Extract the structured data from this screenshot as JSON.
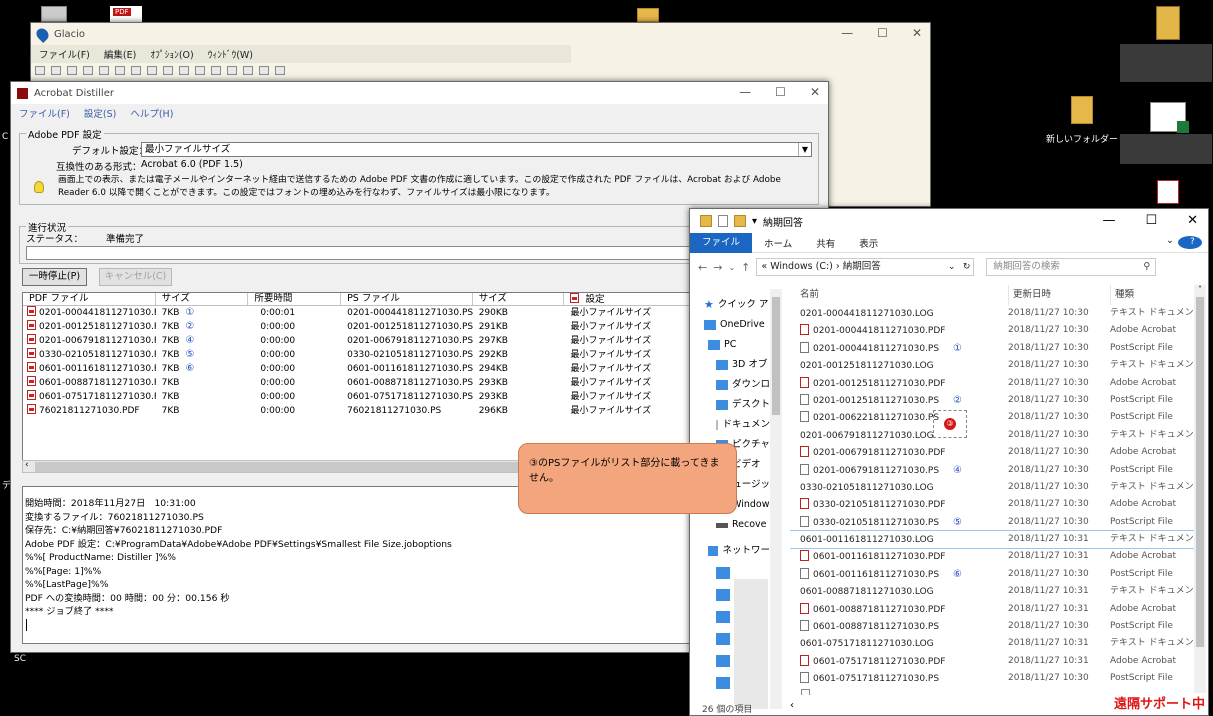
{
  "desktop": {
    "pdf_icon_label": "PDF",
    "new_folder_label": "新しいフォルダー",
    "edge_chars": [
      "C",
      "デ",
      "SC"
    ]
  },
  "glacio": {
    "title": "Glacio",
    "menu": [
      "ファイル(F)",
      "編集(E)",
      "ｵﾌﾟｼｮﾝ(O)",
      "ｳｨﾝﾄﾞｳ(W)"
    ]
  },
  "distiller": {
    "title": "Acrobat Distiller",
    "menu": [
      "ファイル(F)",
      "設定(S)",
      "ヘルプ(H)"
    ],
    "pdf_settings_group": "Adobe PDF 設定",
    "default_settings_label": "デフォルト設定：",
    "default_settings_value": "最小ファイルサイズ",
    "compat_label": "互換性のある形式：",
    "compat_value": "Acrobat 6.0 (PDF 1.5)",
    "description": "画面上での表示、または電子メールやインターネット経由で送信するための Adobe PDF 文書の作成に適しています。この設定で作成された PDF ファイルは、Acrobat および Adobe Reader 6.0 以降で開くことができます。この設定ではフォントの埋め込みを行なわず、ファイルサイズは最小限になります。",
    "progress_group": "進行状況",
    "status_label": "ステータス：",
    "status_value": "準備完了",
    "pause_button": "一時停止(P)",
    "cancel_button": "キャンセル(C)",
    "table_headers": [
      "PDF ファイル",
      "サイズ",
      "所要時間",
      "PS ファイル",
      "サイズ",
      "設定"
    ],
    "rows": [
      {
        "pdf": "0201-000441811271030.P...",
        "size": "7KB",
        "mark": "①",
        "time": "0:00:01",
        "ps": "0201-000441811271030.PS",
        "ps_size": "290KB",
        "setting": "最小ファイルサイズ"
      },
      {
        "pdf": "0201-001251811271030.P...",
        "size": "7KB",
        "mark": "②",
        "time": "0:00:00",
        "ps": "0201-001251811271030.PS",
        "ps_size": "291KB",
        "setting": "最小ファイルサイズ"
      },
      {
        "pdf": "0201-006791811271030.P...",
        "size": "7KB",
        "mark": "④",
        "time": "0:00:00",
        "ps": "0201-006791811271030.PS",
        "ps_size": "297KB",
        "setting": "最小ファイルサイズ"
      },
      {
        "pdf": "0330-021051811271030.P...",
        "size": "7KB",
        "mark": "⑤",
        "time": "0:00:00",
        "ps": "0330-021051811271030.PS",
        "ps_size": "292KB",
        "setting": "最小ファイルサイズ"
      },
      {
        "pdf": "0601-001161811271030.P...",
        "size": "7KB",
        "mark": "⑥",
        "time": "0:00:00",
        "ps": "0601-001161811271030.PS",
        "ps_size": "294KB",
        "setting": "最小ファイルサイズ"
      },
      {
        "pdf": "0601-008871811271030.P...",
        "size": "7KB",
        "mark": "",
        "time": "0:00:00",
        "ps": "0601-008871811271030.PS",
        "ps_size": "293KB",
        "setting": "最小ファイルサイズ"
      },
      {
        "pdf": "0601-075171811271030.P...",
        "size": "7KB",
        "mark": "",
        "time": "0:00:00",
        "ps": "0601-075171811271030.PS",
        "ps_size": "293KB",
        "setting": "最小ファイルサイズ"
      },
      {
        "pdf": "76021811271030.PDF",
        "size": "7KB",
        "mark": "",
        "time": "0:00:00",
        "ps": "76021811271030.PS",
        "ps_size": "296KB",
        "setting": "最小ファイルサイズ"
      }
    ],
    "log_lines": [
      "開始時間：2018年11月27日　10:31:00",
      "変換するファイル：76021811271030.PS",
      "保存先：C:¥納期回答¥76021811271030.PDF",
      "Adobe PDF 設定：C:¥ProgramData¥Adobe¥Adobe PDF¥Settings¥Smallest File Size.joboptions",
      "%%[ ProductName: Distiller ]%%",
      "%%[Page: 1]%%",
      "%%[LastPage]%%",
      "PDF への変換時間：00 時間：00 分：00.156 秒",
      "**** ジョブ終了 ****"
    ]
  },
  "explorer": {
    "title": "納期回答",
    "ribbon_tabs": [
      "ファイル",
      "ホーム",
      "共有",
      "表示"
    ],
    "address": "«  Windows (C:)  ›  納期回答",
    "search_placeholder": "納期回答の検索",
    "columns": [
      "名前",
      "更新日時",
      "種類"
    ],
    "nav_items": [
      "クイック ア",
      "OneDrive",
      "PC",
      "3D オブ",
      "ダウンロ",
      "デスクト",
      "ドキュメン",
      "ピクチャ",
      "ビデオ",
      "ミュージッ",
      "Window",
      "Recove",
      "ネットワー"
    ],
    "files": [
      {
        "name": "0201-000441811271030.LOG",
        "date": "2018/11/27 10:30",
        "type": "テキスト ドキュメント",
        "icon": "log",
        "mark": ""
      },
      {
        "name": "0201-000441811271030.PDF",
        "date": "2018/11/27 10:30",
        "type": "Adobe Acrobat",
        "icon": "pdf",
        "mark": ""
      },
      {
        "name": "0201-000441811271030.PS",
        "date": "2018/11/27 10:30",
        "type": "PostScript File",
        "icon": "ps",
        "mark": "①"
      },
      {
        "name": "0201-001251811271030.LOG",
        "date": "2018/11/27 10:30",
        "type": "テキスト ドキュメント",
        "icon": "log",
        "mark": ""
      },
      {
        "name": "0201-001251811271030.PDF",
        "date": "2018/11/27 10:30",
        "type": "Adobe Acrobat",
        "icon": "pdf",
        "mark": ""
      },
      {
        "name": "0201-001251811271030.PS",
        "date": "2018/11/27 10:30",
        "type": "PostScript File",
        "icon": "ps",
        "mark": "②"
      },
      {
        "name": "0201-006221811271030.PS",
        "date": "2018/11/27 10:30",
        "type": "PostScript File",
        "icon": "ps",
        "mark": ""
      },
      {
        "name": "0201-006791811271030.LOG",
        "date": "2018/11/27 10:30",
        "type": "テキスト ドキュメント",
        "icon": "log",
        "mark": ""
      },
      {
        "name": "0201-006791811271030.PDF",
        "date": "2018/11/27 10:30",
        "type": "Adobe Acrobat",
        "icon": "pdf",
        "mark": ""
      },
      {
        "name": "0201-006791811271030.PS",
        "date": "2018/11/27 10:30",
        "type": "PostScript File",
        "icon": "ps",
        "mark": "④"
      },
      {
        "name": "0330-021051811271030.LOG",
        "date": "2018/11/27 10:30",
        "type": "テキスト ドキュメント",
        "icon": "log",
        "mark": ""
      },
      {
        "name": "0330-021051811271030.PDF",
        "date": "2018/11/27 10:30",
        "type": "Adobe Acrobat",
        "icon": "pdf",
        "mark": ""
      },
      {
        "name": "0330-021051811271030.PS",
        "date": "2018/11/27 10:30",
        "type": "PostScript File",
        "icon": "ps",
        "mark": "⑤"
      },
      {
        "name": "0601-001161811271030.LOG",
        "date": "2018/11/27 10:31",
        "type": "テキスト ドキュメント",
        "icon": "log",
        "mark": ""
      },
      {
        "name": "0601-001161811271030.PDF",
        "date": "2018/11/27 10:31",
        "type": "Adobe Acrobat",
        "icon": "pdf",
        "mark": ""
      },
      {
        "name": "0601-001161811271030.PS",
        "date": "2018/11/27 10:30",
        "type": "PostScript File",
        "icon": "ps",
        "mark": "⑥"
      },
      {
        "name": "0601-008871811271030.LOG",
        "date": "2018/11/27 10:31",
        "type": "テキスト ドキュメント",
        "icon": "log",
        "mark": ""
      },
      {
        "name": "0601-008871811271030.PDF",
        "date": "2018/11/27 10:31",
        "type": "Adobe Acrobat",
        "icon": "pdf",
        "mark": ""
      },
      {
        "name": "0601-008871811271030.PS",
        "date": "2018/11/27 10:30",
        "type": "PostScript File",
        "icon": "ps",
        "mark": ""
      },
      {
        "name": "0601-075171811271030.LOG",
        "date": "2018/11/27 10:31",
        "type": "テキスト ドキュメント",
        "icon": "log",
        "mark": ""
      },
      {
        "name": "0601-075171811271030.PDF",
        "date": "2018/11/27 10:31",
        "type": "Adobe Acrobat",
        "icon": "pdf",
        "mark": ""
      },
      {
        "name": "0601-075171811271030.PS",
        "date": "2018/11/27 10:30",
        "type": "PostScript File",
        "icon": "ps",
        "mark": ""
      }
    ],
    "item_count": "26 個の項目"
  },
  "annotation": {
    "callout_text": "③のPSファイルがリスト部分に載ってきません。",
    "badge": "③"
  },
  "watermark": "遠隔サポート中",
  "colors": {
    "accent": "#1a66c2",
    "callout": "#f3a57e",
    "watermark": "#e01515",
    "marker": "#1f4ac0"
  }
}
